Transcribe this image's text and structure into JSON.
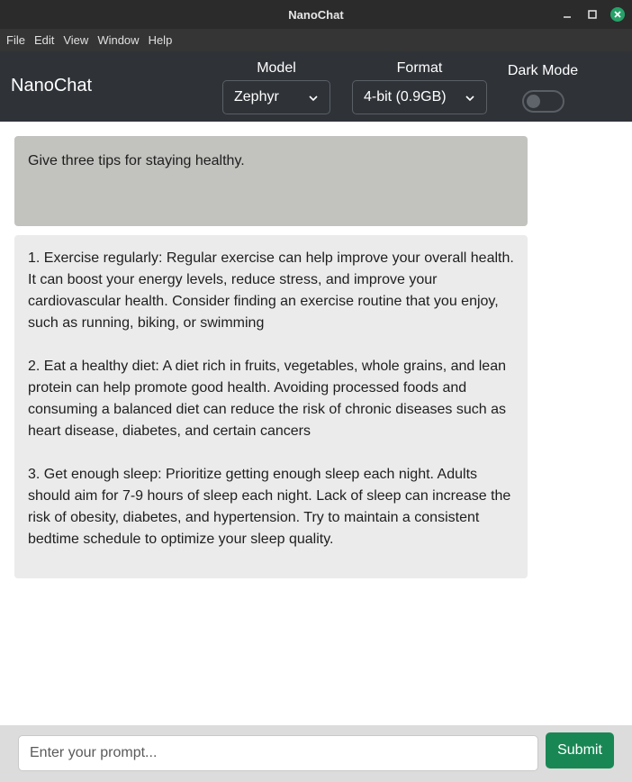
{
  "window": {
    "title": "NanoChat",
    "controls": [
      "minimize-icon",
      "maximize-icon",
      "close-icon"
    ],
    "close_color": "#26a269"
  },
  "menubar": {
    "items": [
      {
        "label": "File"
      },
      {
        "label": "Edit"
      },
      {
        "label": "View"
      },
      {
        "label": "Window"
      },
      {
        "label": "Help"
      }
    ]
  },
  "header": {
    "brand": "NanoChat",
    "model": {
      "label": "Model",
      "selected": "Zephyr"
    },
    "format": {
      "label": "Format",
      "selected": "4-bit (0.9GB)"
    },
    "dark_mode": {
      "label": "Dark Mode",
      "enabled": false
    }
  },
  "chat": {
    "messages": [
      {
        "role": "user",
        "text": "Give three tips for staying healthy."
      },
      {
        "role": "assistant",
        "paragraphs": [
          "1. Exercise regularly: Regular exercise can help improve your overall health. It can boost your energy levels, reduce stress, and improve your cardiovascular health. Consider finding an exercise routine that you enjoy, such as running, biking, or swimming",
          "2. Eat a healthy diet: A diet rich in fruits, vegetables, whole grains, and lean protein can help promote good health. Avoiding processed foods and consuming a balanced diet can reduce the risk of chronic diseases such as heart disease, diabetes, and certain cancers",
          "3. Get enough sleep: Prioritize getting enough sleep each night. Adults should aim for 7-9 hours of sleep each night. Lack of sleep can increase the risk of obesity, diabetes, and hypertension. Try to maintain a consistent bedtime schedule to optimize your sleep quality."
        ]
      }
    ]
  },
  "composer": {
    "placeholder": "Enter your prompt...",
    "value": "",
    "submit_label": "Submit",
    "submit_color": "#198754"
  }
}
